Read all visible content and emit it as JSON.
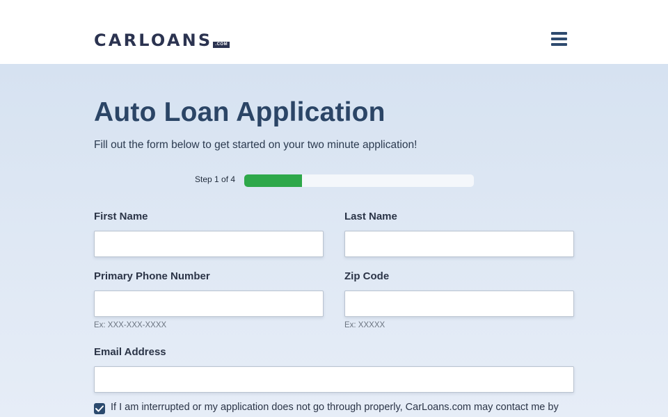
{
  "header": {
    "logo_text": "CARLOANS",
    "logo_suffix": ".COM",
    "menu_icon": "hamburger-menu-icon"
  },
  "main": {
    "title": "Auto Loan Application",
    "subtitle": "Fill out the form below to get started on your two minute application!",
    "progress": {
      "label": "Step 1 of 4",
      "current_step": 1,
      "total_steps": 4,
      "fraction_complete": 0.25
    },
    "fields": {
      "first_name": {
        "label": "First Name",
        "value": ""
      },
      "last_name": {
        "label": "Last Name",
        "value": ""
      },
      "phone": {
        "label": "Primary Phone Number",
        "value": "",
        "hint": "Ex: XXX-XXX-XXXX"
      },
      "zip": {
        "label": "Zip Code",
        "value": "",
        "hint": "Ex: XXXXX"
      },
      "email": {
        "label": "Email Address",
        "value": ""
      }
    },
    "consent": {
      "checked": true,
      "text": "If I am interrupted or my application does not go through properly, CarLoans.com may contact me by"
    }
  },
  "colors": {
    "brand_navy": "#2b3350",
    "title_blue": "#2b4566",
    "progress_green": "#2ea84a",
    "checkbox_blue": "#2b4a6e"
  }
}
